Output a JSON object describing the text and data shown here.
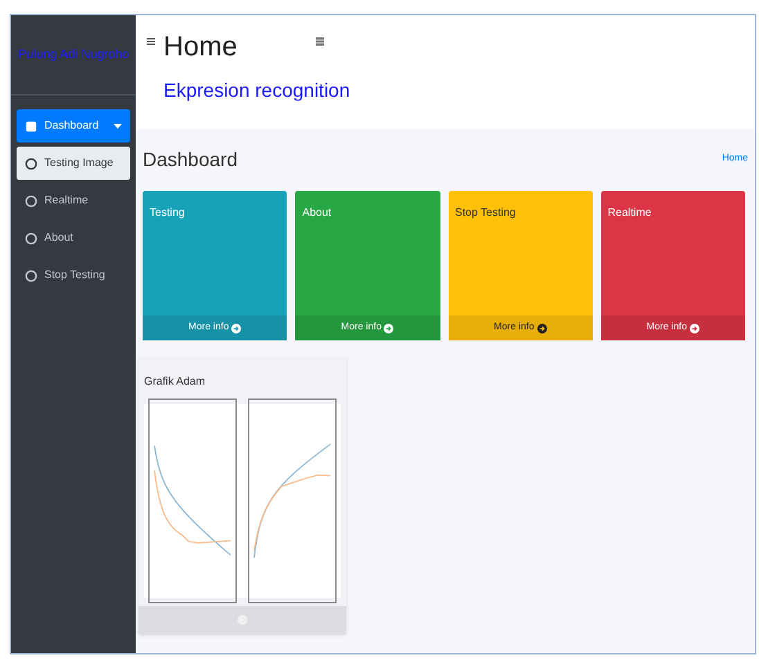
{
  "sidebar": {
    "brand": "Pulung Adi Nugroho",
    "items": [
      {
        "label": "Dashboard",
        "selected": true,
        "expanded": true,
        "children": [
          {
            "label": "Testing Image",
            "selected": true
          }
        ]
      },
      {
        "label": "Realtime",
        "selected": false
      },
      {
        "label": "About",
        "selected": false
      },
      {
        "label": "Stop Testing",
        "selected": false
      }
    ]
  },
  "header": {
    "title": "Home",
    "subtitle": "Ekpresion recognition"
  },
  "content": {
    "heading": "Dashboard",
    "breadcrumb": "Home",
    "cards": [
      {
        "title": "Testing",
        "color": "#17a2b8",
        "footer": "More info"
      },
      {
        "title": "About",
        "color": "#28a745",
        "footer": "More info"
      },
      {
        "title": "Stop Testing",
        "color": "#ffc107",
        "footer": "More info"
      },
      {
        "title": "Realtime",
        "color": "#dc3545",
        "footer": "More info"
      }
    ],
    "chart_card": {
      "title": "Grafik Adam"
    }
  }
}
